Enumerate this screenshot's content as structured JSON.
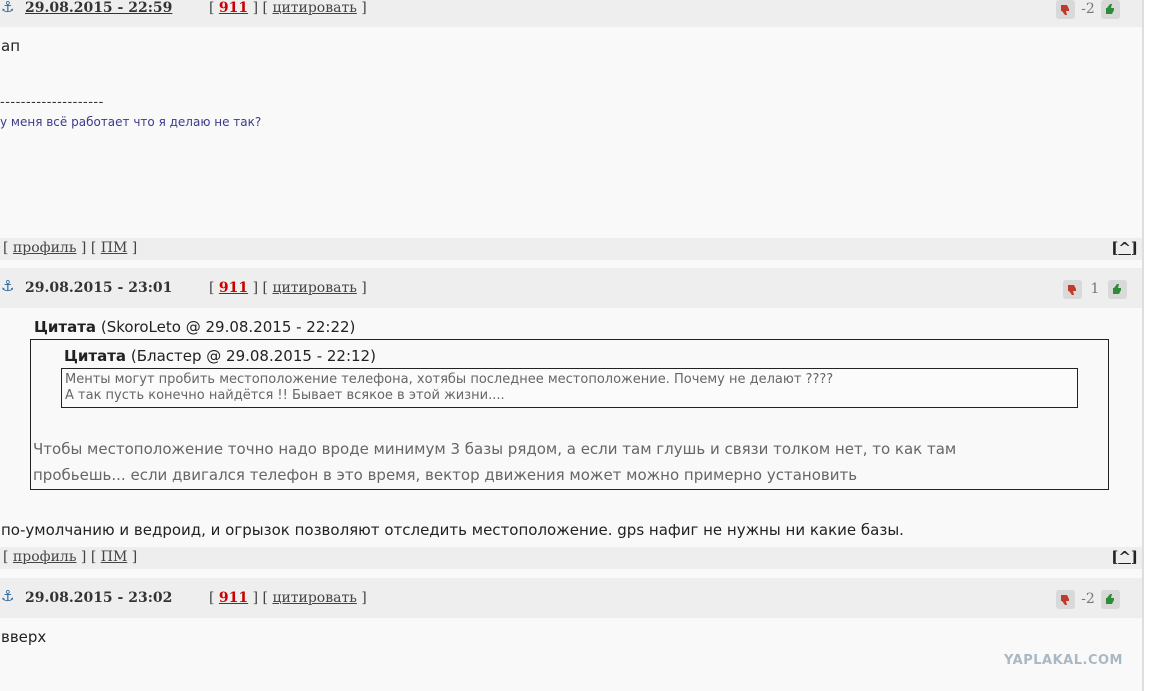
{
  "posts": [
    {
      "date": "29.08.2015 - 22:59",
      "number": "911",
      "quote_link": "цитировать",
      "rating": "-2",
      "body": "ап",
      "signature_separator": "--------------------",
      "signature": "у меня всё работает что я делаю не так?"
    },
    {
      "date": "29.08.2015 - 23:01",
      "number": "911",
      "quote_link": "цитировать",
      "rating": "1",
      "outer_quote": {
        "label": "Цитата",
        "source": "(SkoroLeto @ 29.08.2015 - 22:22)",
        "inner_quote": {
          "label": "Цитата",
          "source": "(Бластер @ 29.08.2015 - 22:12)",
          "line1": "Менты могут пробить местоположение телефона, хотябы последнее местоположение. Почему не делают ????",
          "line2": "А так пусть конечно найдётся !! Бывает всякое в этой жизни...."
        },
        "line1": "Чтобы местоположение точно надо вроде минимум 3 базы рядом, а если там глушь и связи толком нет, то как там",
        "line2": "пробьешь... если двигался телефон в это время, вектор движения может можно примерно установить"
      },
      "body": "по-умолчанию и ведроид, и огрызок позволяют отследить местоположение. gps нафиг не нужны ни какие базы."
    },
    {
      "date": "29.08.2015 - 23:02",
      "number": "911",
      "quote_link": "цитировать",
      "rating": "-2",
      "body": "вверх"
    }
  ],
  "footer": {
    "profile": "профиль",
    "pm": "ПМ",
    "to_top": "^"
  },
  "watermark": "YAPLAKAL.COM",
  "colors": {
    "header_bg": "#eeeeee",
    "number_red": "#cc0000",
    "anchor_blue": "#2a6aa0",
    "thumb_down": "#c0392b",
    "thumb_up": "#2e8b3a"
  }
}
